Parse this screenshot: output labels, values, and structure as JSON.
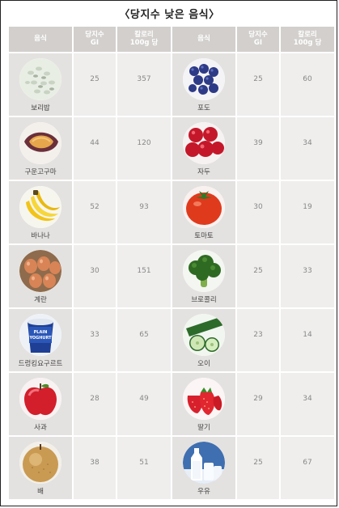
{
  "title": "〈당지수 낮은 음식〉",
  "headers": {
    "food": "음식",
    "gi": "당지수\nGI",
    "cal": "칼로리\n100g 당"
  },
  "rows": [
    {
      "left": {
        "name": "보리밥",
        "gi": "25",
        "cal": "357",
        "icon": "barley-rice-icon"
      },
      "right": {
        "name": "포도",
        "gi": "25",
        "cal": "60",
        "icon": "grape-icon"
      }
    },
    {
      "left": {
        "name": "구운고구마",
        "gi": "44",
        "cal": "120",
        "icon": "sweet-potato-icon"
      },
      "right": {
        "name": "자두",
        "gi": "39",
        "cal": "34",
        "icon": "plum-icon"
      }
    },
    {
      "left": {
        "name": "바나나",
        "gi": "52",
        "cal": "93",
        "icon": "banana-icon"
      },
      "right": {
        "name": "토마토",
        "gi": "30",
        "cal": "19",
        "icon": "tomato-icon"
      }
    },
    {
      "left": {
        "name": "계란",
        "gi": "30",
        "cal": "151",
        "icon": "egg-icon"
      },
      "right": {
        "name": "브로콜리",
        "gi": "25",
        "cal": "33",
        "icon": "broccoli-icon"
      }
    },
    {
      "left": {
        "name": "드렁킹요구르트",
        "gi": "33",
        "cal": "65",
        "icon": "yogurt-icon"
      },
      "right": {
        "name": "오이",
        "gi": "23",
        "cal": "14",
        "icon": "cucumber-icon"
      }
    },
    {
      "left": {
        "name": "사과",
        "gi": "28",
        "cal": "49",
        "icon": "apple-icon"
      },
      "right": {
        "name": "딸기",
        "gi": "29",
        "cal": "34",
        "icon": "strawberry-icon"
      }
    },
    {
      "left": {
        "name": "배",
        "gi": "38",
        "cal": "51",
        "icon": "pear-icon"
      },
      "right": {
        "name": "우유",
        "gi": "25",
        "cal": "67",
        "icon": "milk-icon"
      }
    }
  ],
  "yogurt_label": "PLAIN\nYOGHURT"
}
